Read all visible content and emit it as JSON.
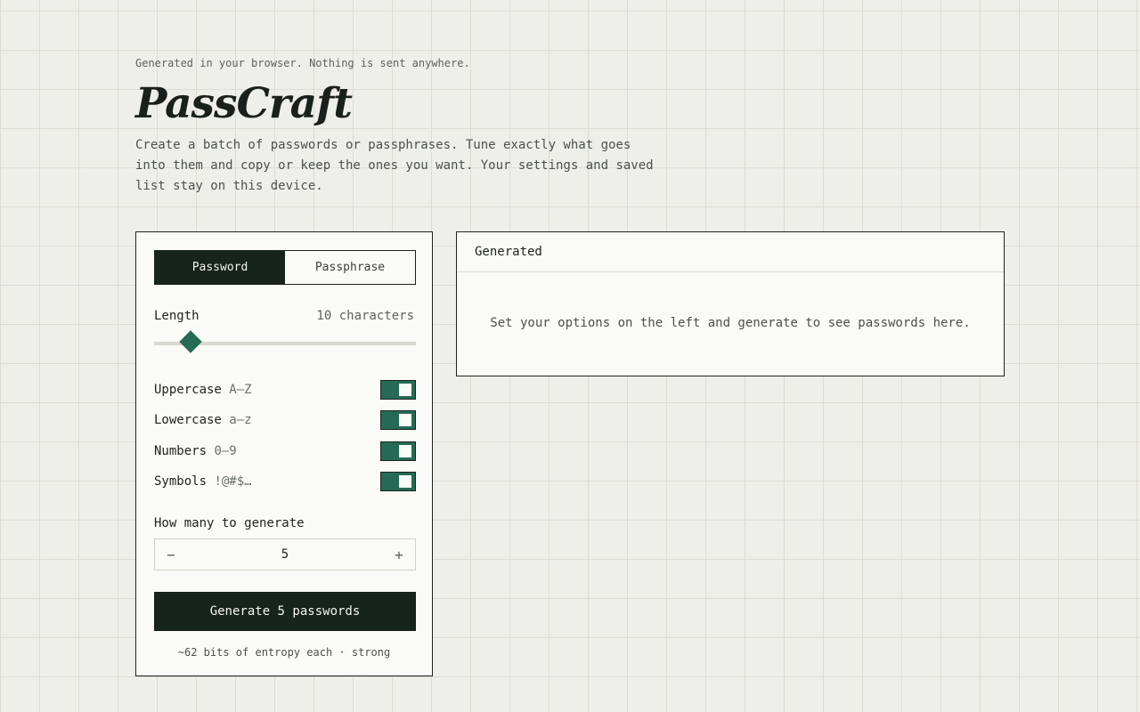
{
  "header": {
    "tagline": "Generated in your browser. Nothing is sent anywhere.",
    "title": "PassCraft",
    "intro": "Create a batch of passwords or passphrases. Tune exactly what goes into them and copy or keep the ones you want. Your settings and saved list stay on this device."
  },
  "settings": {
    "tabs": [
      {
        "label": "Password",
        "active": true
      },
      {
        "label": "Passphrase",
        "active": false
      }
    ],
    "length": {
      "label": "Length",
      "value_text": "10 characters",
      "value": 10,
      "min": 6,
      "max": 64
    },
    "options": [
      {
        "label": "Uppercase",
        "hint": "A–Z",
        "enabled": true
      },
      {
        "label": "Lowercase",
        "hint": "a–z",
        "enabled": true
      },
      {
        "label": "Numbers",
        "hint": "0–9",
        "enabled": true
      },
      {
        "label": "Symbols",
        "hint": "!@#$…",
        "enabled": true
      }
    ],
    "count": {
      "label": "How many to generate",
      "value": "5",
      "decrement_symbol": "−",
      "increment_symbol": "+"
    },
    "generate_label": "Generate 5 passwords",
    "entropy_text": "~62 bits of entropy each · strong"
  },
  "results": {
    "title": "Generated",
    "empty_text": "Set your options on the left and generate to see passwords here."
  },
  "colors": {
    "accent": "#256a55",
    "dark": "#17231d",
    "panel": "#fafaf6",
    "background": "#efefea"
  }
}
